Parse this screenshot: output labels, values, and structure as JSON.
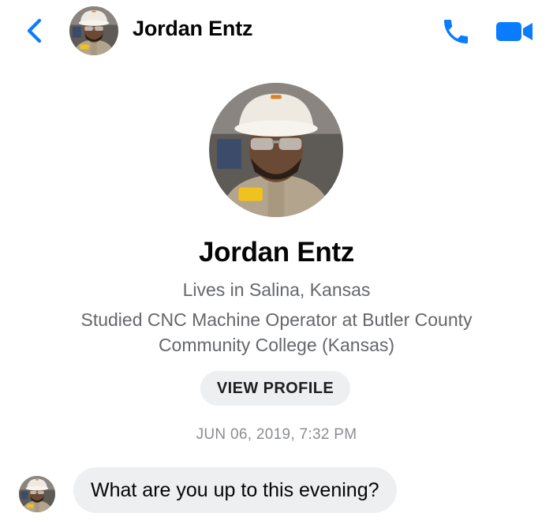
{
  "header": {
    "contact_name": "Jordan Entz",
    "back_icon": "chevron-left-icon",
    "call_icon": "phone-icon",
    "video_icon": "video-camera-icon",
    "accent_color": "#0a7cff"
  },
  "profile": {
    "name": "Jordan Entz",
    "location": "Lives in Salina, Kansas",
    "education_line1": "Studied CNC Machine Operator at Butler County",
    "education_line2": "Community College (Kansas)",
    "view_profile_label": "VIEW PROFILE"
  },
  "conversation": {
    "timestamp": "JUN 06, 2019, 7:32 PM",
    "messages": [
      {
        "text": "What are you up to this evening?"
      }
    ]
  },
  "colors": {
    "accent": "#0a7cff",
    "secondary_text": "#65676b",
    "timestamp_text": "#8a8d91",
    "bubble_background": "#eeeff1"
  }
}
